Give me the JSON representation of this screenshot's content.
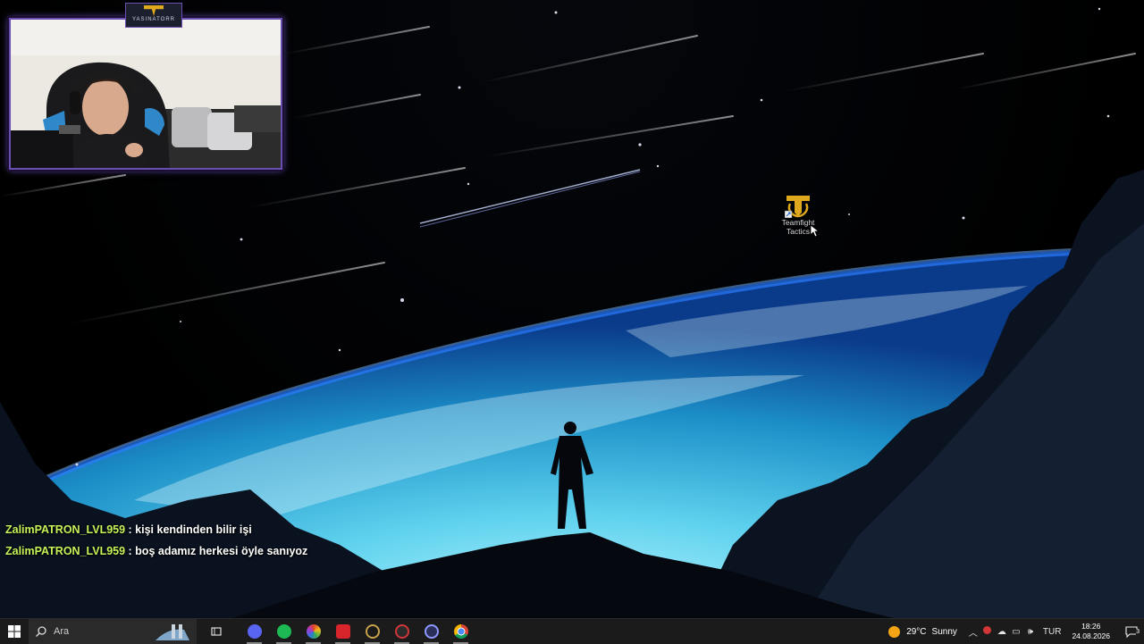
{
  "webcam": {
    "badge_name": "YASINATORR"
  },
  "desktop_icon": {
    "label_line1": "Teamfight",
    "label_line2": "Tactics",
    "icon": "teamfight-tactics-icon"
  },
  "chat": [
    {
      "user": "ZalimPATRON_LVL959",
      "sep": " : ",
      "message": "kişi kendinden bilir işi"
    },
    {
      "user": "ZalimPATRON_LVL959",
      "sep": " : ",
      "message": "boş adamız herkesi öyle sanıyoz"
    }
  ],
  "taskbar": {
    "search_placeholder": "Ara",
    "apps": [
      {
        "name": "discord-app",
        "color": "#5865f2"
      },
      {
        "name": "spotify-app",
        "color": "#1db954"
      },
      {
        "name": "colorful-app",
        "color": "#e0452a"
      },
      {
        "name": "red-app",
        "color": "#d8242b"
      },
      {
        "name": "league-of-legends-app",
        "color": "#c8a14a"
      },
      {
        "name": "riot-client-app",
        "color": "#d13639"
      },
      {
        "name": "steelseries-app",
        "color": "#5f6bc8"
      },
      {
        "name": "chrome-app",
        "color": "#fbbc05"
      }
    ],
    "weather": {
      "temp": "29°C",
      "condition": "Sunny"
    },
    "language": "TUR",
    "time": "18:26",
    "date": "24.08.2026",
    "notification_count": "3"
  }
}
